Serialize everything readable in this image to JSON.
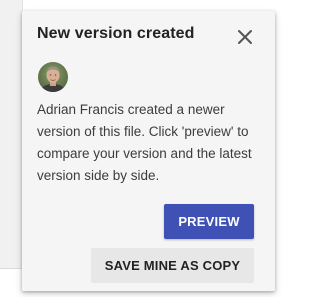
{
  "dialog": {
    "title": "New version created",
    "close_icon": "close-icon",
    "avatar_icon": "user-avatar-photo",
    "message": "Adrian Francis created a newer version of this file. Click 'preview' to compare your version and the latest version side by side.",
    "preview_label": "PREVIEW",
    "save_copy_label": "SAVE MINE AS COPY"
  },
  "colors": {
    "accent": "#3f51b5",
    "dialog_background": "#f5f5f5",
    "secondary_button": "#e7e7e7"
  }
}
